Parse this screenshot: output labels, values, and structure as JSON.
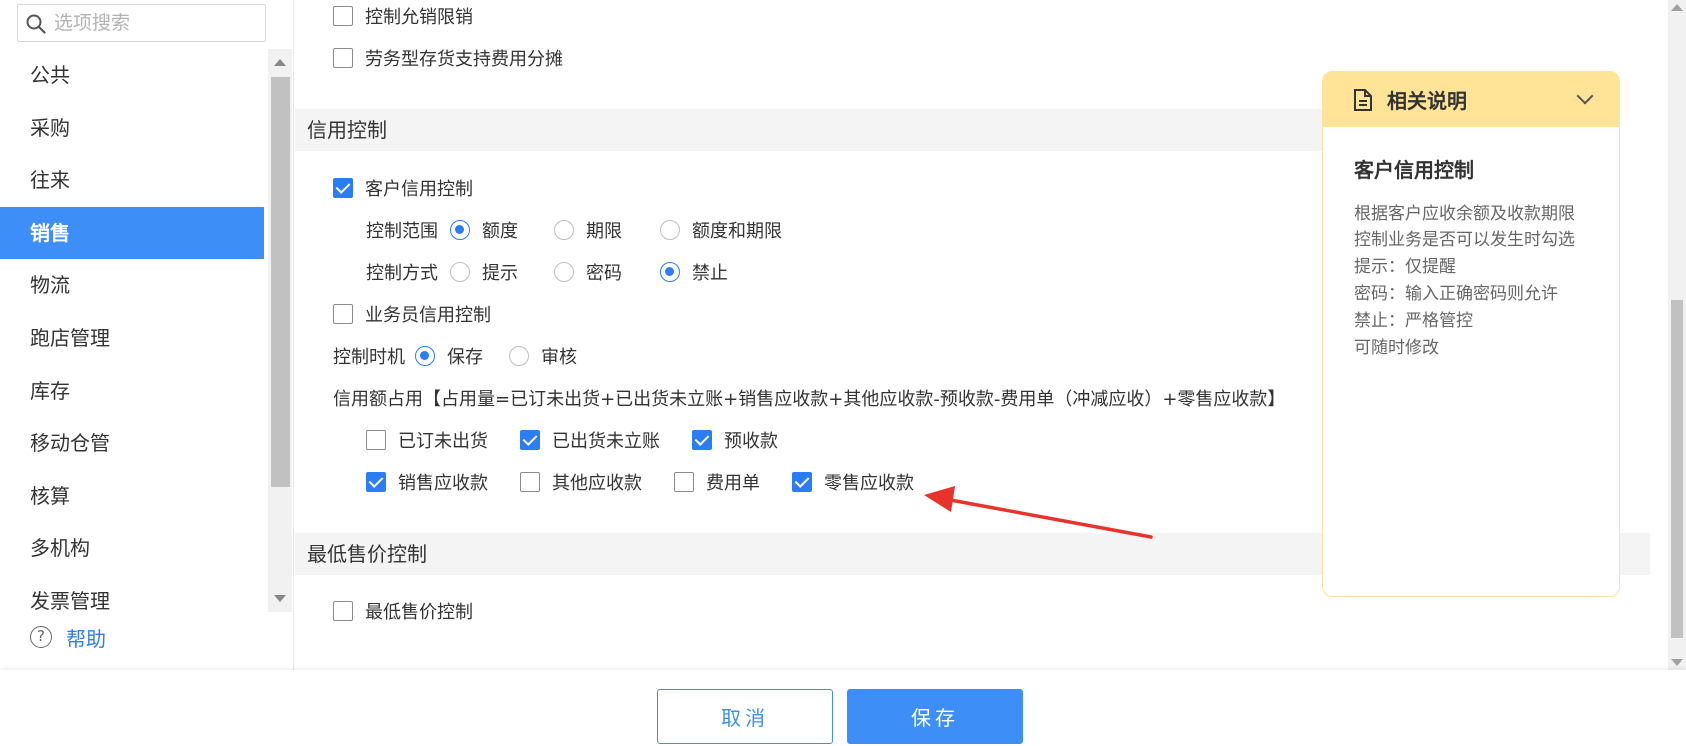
{
  "search": {
    "placeholder": "选项搜索"
  },
  "sidebar": {
    "items": [
      {
        "label": "公共"
      },
      {
        "label": "采购"
      },
      {
        "label": "往来"
      },
      {
        "label": "销售"
      },
      {
        "label": "物流"
      },
      {
        "label": "跑店管理"
      },
      {
        "label": "库存"
      },
      {
        "label": "移动仓管"
      },
      {
        "label": "核算"
      },
      {
        "label": "多机构"
      },
      {
        "label": "发票管理"
      }
    ],
    "active_index": 3,
    "help_label": "帮助"
  },
  "main": {
    "top_options": [
      {
        "label": "控制允销限销",
        "checked": false
      },
      {
        "label": "劳务型存货支持费用分摊",
        "checked": false
      }
    ],
    "credit_section": {
      "title": "信用控制",
      "customer_credit": {
        "label": "客户信用控制",
        "checked": true
      },
      "scope": {
        "label": "控制范围",
        "options": [
          {
            "label": "额度",
            "selected": true
          },
          {
            "label": "期限",
            "selected": false
          },
          {
            "label": "额度和期限",
            "selected": false
          }
        ]
      },
      "mode": {
        "label": "控制方式",
        "options": [
          {
            "label": "提示",
            "selected": false
          },
          {
            "label": "密码",
            "selected": false
          },
          {
            "label": "禁止",
            "selected": true
          }
        ]
      },
      "salesman_credit": {
        "label": "业务员信用控制",
        "checked": false
      },
      "timing": {
        "label": "控制时机",
        "options": [
          {
            "label": "保存",
            "selected": true
          },
          {
            "label": "审核",
            "selected": false
          }
        ]
      },
      "formula": "信用额占用【占用量=已订未出货+已出货未立账+销售应收款+其他应收款-预收款-费用单（冲减应收）+零售应收款】",
      "occupancy_row1": [
        {
          "label": "已订未出货",
          "checked": false
        },
        {
          "label": "已出货未立账",
          "checked": true
        },
        {
          "label": "预收款",
          "checked": true
        }
      ],
      "occupancy_row2": [
        {
          "label": "销售应收款",
          "checked": true
        },
        {
          "label": "其他应收款",
          "checked": false
        },
        {
          "label": "费用单",
          "checked": false
        },
        {
          "label": "零售应收款",
          "checked": true
        }
      ]
    },
    "min_price_section": {
      "title": "最低售价控制",
      "option": {
        "label": "最低售价控制",
        "checked": false
      }
    }
  },
  "note_panel": {
    "header": "相关说明",
    "subtitle": "客户信用控制",
    "lines": [
      "根据客户应收余额及收款期限",
      "控制业务是否可以发生时勾选",
      "提示：仅提醒",
      "密码：输入正确密码则允许",
      "禁止：严格管控",
      "可随时修改"
    ]
  },
  "footer": {
    "cancel_label": "取消",
    "save_label": "保存"
  },
  "colors": {
    "accent": "#3d8ef7",
    "note_header_bg": "#ffe396",
    "annotation_arrow": "#e8332a"
  }
}
